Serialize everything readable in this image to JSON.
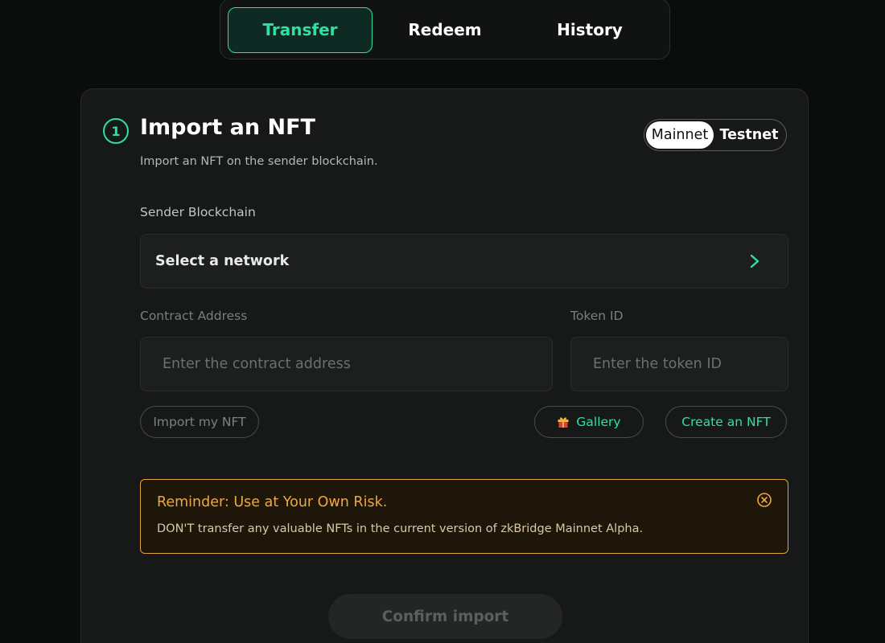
{
  "tabs": [
    {
      "label": "Transfer",
      "active": true
    },
    {
      "label": "Redeem",
      "active": false
    },
    {
      "label": "History",
      "active": false
    }
  ],
  "step": {
    "number": "1",
    "title": "Import an NFT",
    "subtitle": "Import an NFT on the sender blockchain."
  },
  "network_toggle": {
    "options": [
      "Mainnet",
      "Testnet"
    ],
    "selected": "Mainnet"
  },
  "sender_blockchain": {
    "label": "Sender Blockchain",
    "value": "Select a network"
  },
  "contract_address": {
    "label": "Contract Address",
    "placeholder": "Enter the contract address"
  },
  "token_id": {
    "label": "Token ID",
    "placeholder": "Enter the token ID"
  },
  "actions": {
    "import_label": "Import my NFT",
    "gallery_label": "Gallery",
    "create_label": "Create an NFT"
  },
  "reminder": {
    "title": "Reminder: Use at Your Own Risk.",
    "body": "DON'T transfer any valuable NFTs in the current version of zkBridge Mainnet Alpha."
  },
  "confirm": {
    "label": "Confirm import"
  },
  "colors": {
    "accent": "#2fe0a6",
    "warning": "#f0a83b",
    "background": "#0b0c0c",
    "card": "#171818"
  },
  "icons": {
    "select_arrow": "chevron-right-icon",
    "gallery": "gift-icon",
    "reminder_close": "close-circle-icon"
  }
}
